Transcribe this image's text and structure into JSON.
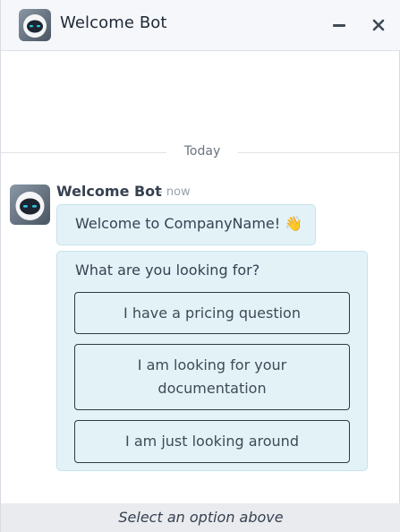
{
  "header": {
    "title": "Welcome Bot",
    "avatar_icon": "robot-avatar-icon",
    "minimize_icon": "minimize-icon",
    "close_icon": "close-icon"
  },
  "separator": {
    "label": "Today"
  },
  "message": {
    "author": "Welcome Bot",
    "time": "- now",
    "text": "Welcome to CompanyName! 👋",
    "question": "What are you looking for?",
    "options": [
      "I have a pricing question",
      "I am looking for your documentation",
      "I am just looking around"
    ]
  },
  "footer": {
    "text": "Select an option above"
  },
  "colors": {
    "bubble_bg": "#e3f2f7",
    "bubble_border": "#c5e3ec",
    "header_bg": "#f5f7fa",
    "footer_bg": "#e9ebee",
    "robot_eye": "#2ec8e6"
  }
}
